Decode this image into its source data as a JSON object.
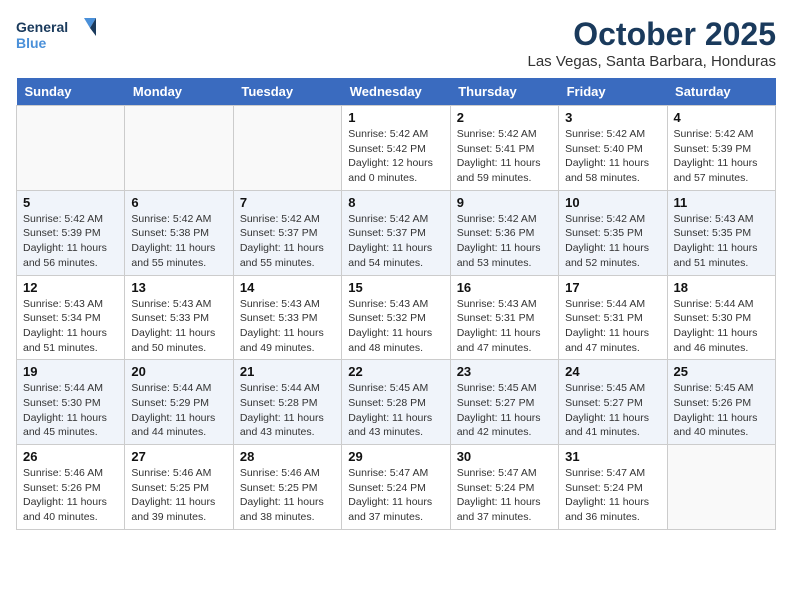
{
  "header": {
    "logo_line1": "General",
    "logo_line2": "Blue",
    "title": "October 2025",
    "subtitle": "Las Vegas, Santa Barbara, Honduras"
  },
  "days_of_week": [
    "Sunday",
    "Monday",
    "Tuesday",
    "Wednesday",
    "Thursday",
    "Friday",
    "Saturday"
  ],
  "weeks": [
    [
      {
        "day": "",
        "info": ""
      },
      {
        "day": "",
        "info": ""
      },
      {
        "day": "",
        "info": ""
      },
      {
        "day": "1",
        "info": "Sunrise: 5:42 AM\nSunset: 5:42 PM\nDaylight: 12 hours\nand 0 minutes."
      },
      {
        "day": "2",
        "info": "Sunrise: 5:42 AM\nSunset: 5:41 PM\nDaylight: 11 hours\nand 59 minutes."
      },
      {
        "day": "3",
        "info": "Sunrise: 5:42 AM\nSunset: 5:40 PM\nDaylight: 11 hours\nand 58 minutes."
      },
      {
        "day": "4",
        "info": "Sunrise: 5:42 AM\nSunset: 5:39 PM\nDaylight: 11 hours\nand 57 minutes."
      }
    ],
    [
      {
        "day": "5",
        "info": "Sunrise: 5:42 AM\nSunset: 5:39 PM\nDaylight: 11 hours\nand 56 minutes."
      },
      {
        "day": "6",
        "info": "Sunrise: 5:42 AM\nSunset: 5:38 PM\nDaylight: 11 hours\nand 55 minutes."
      },
      {
        "day": "7",
        "info": "Sunrise: 5:42 AM\nSunset: 5:37 PM\nDaylight: 11 hours\nand 55 minutes."
      },
      {
        "day": "8",
        "info": "Sunrise: 5:42 AM\nSunset: 5:37 PM\nDaylight: 11 hours\nand 54 minutes."
      },
      {
        "day": "9",
        "info": "Sunrise: 5:42 AM\nSunset: 5:36 PM\nDaylight: 11 hours\nand 53 minutes."
      },
      {
        "day": "10",
        "info": "Sunrise: 5:42 AM\nSunset: 5:35 PM\nDaylight: 11 hours\nand 52 minutes."
      },
      {
        "day": "11",
        "info": "Sunrise: 5:43 AM\nSunset: 5:35 PM\nDaylight: 11 hours\nand 51 minutes."
      }
    ],
    [
      {
        "day": "12",
        "info": "Sunrise: 5:43 AM\nSunset: 5:34 PM\nDaylight: 11 hours\nand 51 minutes."
      },
      {
        "day": "13",
        "info": "Sunrise: 5:43 AM\nSunset: 5:33 PM\nDaylight: 11 hours\nand 50 minutes."
      },
      {
        "day": "14",
        "info": "Sunrise: 5:43 AM\nSunset: 5:33 PM\nDaylight: 11 hours\nand 49 minutes."
      },
      {
        "day": "15",
        "info": "Sunrise: 5:43 AM\nSunset: 5:32 PM\nDaylight: 11 hours\nand 48 minutes."
      },
      {
        "day": "16",
        "info": "Sunrise: 5:43 AM\nSunset: 5:31 PM\nDaylight: 11 hours\nand 47 minutes."
      },
      {
        "day": "17",
        "info": "Sunrise: 5:44 AM\nSunset: 5:31 PM\nDaylight: 11 hours\nand 47 minutes."
      },
      {
        "day": "18",
        "info": "Sunrise: 5:44 AM\nSunset: 5:30 PM\nDaylight: 11 hours\nand 46 minutes."
      }
    ],
    [
      {
        "day": "19",
        "info": "Sunrise: 5:44 AM\nSunset: 5:30 PM\nDaylight: 11 hours\nand 45 minutes."
      },
      {
        "day": "20",
        "info": "Sunrise: 5:44 AM\nSunset: 5:29 PM\nDaylight: 11 hours\nand 44 minutes."
      },
      {
        "day": "21",
        "info": "Sunrise: 5:44 AM\nSunset: 5:28 PM\nDaylight: 11 hours\nand 43 minutes."
      },
      {
        "day": "22",
        "info": "Sunrise: 5:45 AM\nSunset: 5:28 PM\nDaylight: 11 hours\nand 43 minutes."
      },
      {
        "day": "23",
        "info": "Sunrise: 5:45 AM\nSunset: 5:27 PM\nDaylight: 11 hours\nand 42 minutes."
      },
      {
        "day": "24",
        "info": "Sunrise: 5:45 AM\nSunset: 5:27 PM\nDaylight: 11 hours\nand 41 minutes."
      },
      {
        "day": "25",
        "info": "Sunrise: 5:45 AM\nSunset: 5:26 PM\nDaylight: 11 hours\nand 40 minutes."
      }
    ],
    [
      {
        "day": "26",
        "info": "Sunrise: 5:46 AM\nSunset: 5:26 PM\nDaylight: 11 hours\nand 40 minutes."
      },
      {
        "day": "27",
        "info": "Sunrise: 5:46 AM\nSunset: 5:25 PM\nDaylight: 11 hours\nand 39 minutes."
      },
      {
        "day": "28",
        "info": "Sunrise: 5:46 AM\nSunset: 5:25 PM\nDaylight: 11 hours\nand 38 minutes."
      },
      {
        "day": "29",
        "info": "Sunrise: 5:47 AM\nSunset: 5:24 PM\nDaylight: 11 hours\nand 37 minutes."
      },
      {
        "day": "30",
        "info": "Sunrise: 5:47 AM\nSunset: 5:24 PM\nDaylight: 11 hours\nand 37 minutes."
      },
      {
        "day": "31",
        "info": "Sunrise: 5:47 AM\nSunset: 5:24 PM\nDaylight: 11 hours\nand 36 minutes."
      },
      {
        "day": "",
        "info": ""
      }
    ]
  ]
}
